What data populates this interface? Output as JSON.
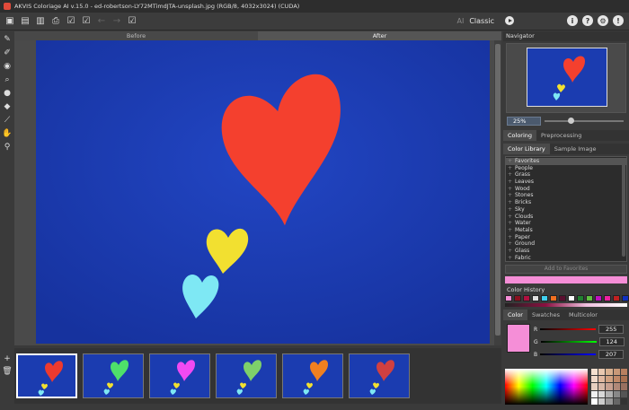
{
  "window": {
    "title": "AKVIS Coloriage AI v.15.0 - ed-robertson-LY72MTimdJTA-unsplash.jpg (RGB/8, 4032x3024) (CUDA)"
  },
  "toolbar": {
    "icons": [
      "open-icon",
      "save-icon",
      "export-icon",
      "print-icon",
      "check-icon",
      "check-icon",
      "undo-icon",
      "redo-icon",
      "check-icon"
    ],
    "mode_ai": "AI",
    "mode_classic": "Classic"
  },
  "header_icons": [
    "info-icon",
    "help-icon",
    "settings-icon",
    "notifications-icon"
  ],
  "left_tools": [
    "pencil-icon",
    "color-brush-icon",
    "fill-icon",
    "dropper-icon",
    "brush-icon",
    "eraser-icon",
    "eyedropper-icon",
    "hand-icon",
    "zoom-icon"
  ],
  "canvas": {
    "before_label": "Before",
    "after_label": "After"
  },
  "filmstrip": {
    "thumbs": [
      {
        "color": "#ee3a2e"
      },
      {
        "color": "#4ee06a"
      },
      {
        "color": "#f04af2"
      },
      {
        "color": "#7ed06a"
      },
      {
        "color": "#f08020"
      },
      {
        "color": "#d04040"
      }
    ]
  },
  "navigator": {
    "label": "Navigator",
    "zoom": "25%"
  },
  "main_tabs": {
    "coloring": "Coloring",
    "preprocessing": "Preprocessing"
  },
  "sub_tabs": {
    "library": "Color Library",
    "sample": "Sample Image"
  },
  "library": {
    "items": [
      "Favorites",
      "People",
      "Grass",
      "Leaves",
      "Wood",
      "Stones",
      "Bricks",
      "Sky",
      "Clouds",
      "Water",
      "Metals",
      "Paper",
      "Ground",
      "Glass",
      "Fabric"
    ]
  },
  "add_favorites": "Add to Favorites",
  "color_history": {
    "label": "Color History",
    "colors": [
      "#f58ed7",
      "#8a1020",
      "#b01040",
      "#e0e0e0",
      "#40d0f0",
      "#f07020",
      "#5a1030",
      "#ffffff",
      "#208030",
      "#60c040",
      "#c010c0",
      "#f020a0",
      "#c02020",
      "#1030c0"
    ]
  },
  "color_tabs": {
    "color": "Color",
    "swatches": "Swatches",
    "multicolor": "Multicolor"
  },
  "current_color": {
    "hex": "#f58ed7",
    "r_label": "R",
    "g_label": "G",
    "b_label": "B",
    "r": "255",
    "g": "124",
    "b": "207"
  }
}
